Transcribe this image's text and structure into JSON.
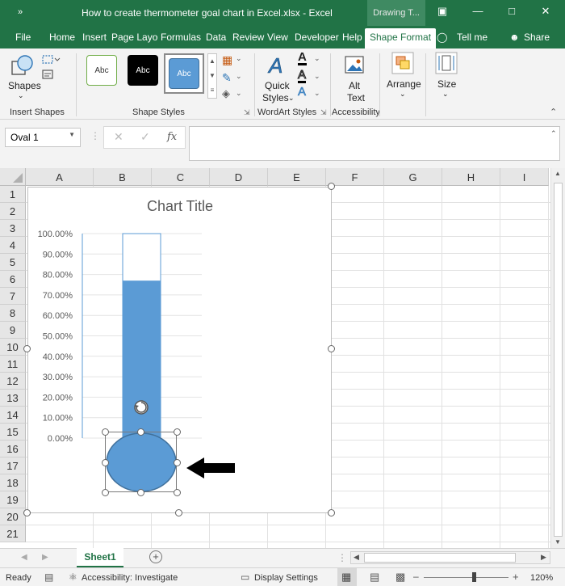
{
  "window": {
    "title": "How to create thermometer goal chart in Excel.xlsx  -  Excel",
    "context_tab": "Drawing T...",
    "qat_icon": "quick-access-chevrons"
  },
  "tabs": [
    "File",
    "Home",
    "Insert",
    "Page Layo",
    "Formulas",
    "Data",
    "Review",
    "View",
    "Developer",
    "Help",
    "Shape Format"
  ],
  "active_tab": "Shape Format",
  "tell_me": "Tell me",
  "share": "Share",
  "ribbon": {
    "shapes_label": "Shapes",
    "insert_shapes_group": "Insert Shapes",
    "shape_styles_group": "Shape Styles",
    "style_samples": [
      "Abc",
      "Abc",
      "Abc"
    ],
    "quick_styles_line1": "Quick",
    "quick_styles_line2": "Styles",
    "wordart_group": "WordArt Styles",
    "alt_text_line1": "Alt",
    "alt_text_line2": "Text",
    "accessibility_group": "Accessibility",
    "arrange_label": "Arrange",
    "size_label": "Size"
  },
  "formula_bar": {
    "name_box": "Oval 1",
    "fx": "fx",
    "formula": ""
  },
  "columns": [
    "A",
    "B",
    "C",
    "D",
    "E",
    "F",
    "G",
    "H",
    "I"
  ],
  "rows": [
    "1",
    "2",
    "3",
    "4",
    "5",
    "6",
    "7",
    "8",
    "9",
    "10",
    "11",
    "12",
    "13",
    "14",
    "15",
    "16",
    "17",
    "18",
    "19",
    "20",
    "21"
  ],
  "chart_data": {
    "type": "bar",
    "title": "Chart Title",
    "categories": [
      ""
    ],
    "values": [
      0.77
    ],
    "ylim": [
      0,
      1
    ],
    "yticks": [
      "100.00%",
      "90.00%",
      "80.00%",
      "70.00%",
      "60.00%",
      "50.00%",
      "40.00%",
      "30.00%",
      "20.00%",
      "10.00%",
      "0.00%"
    ],
    "bar_color": "#5b9bd5"
  },
  "sheets": [
    "Sheet1"
  ],
  "status": {
    "ready": "Ready",
    "accessibility": "Accessibility: Investigate",
    "display_settings": "Display Settings",
    "zoom": "120%"
  },
  "colors": {
    "excel_green": "#217346",
    "bar_blue": "#5b9bd5",
    "bar_border": "#41719c"
  }
}
